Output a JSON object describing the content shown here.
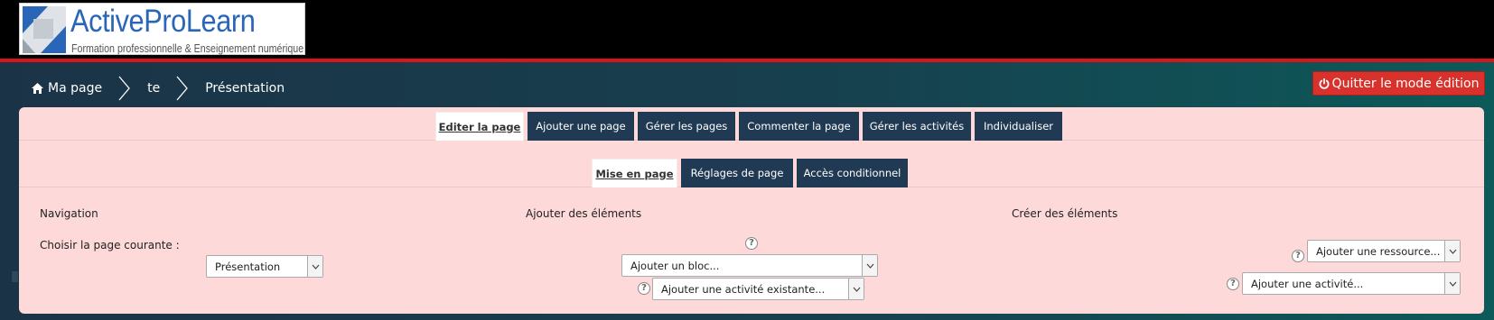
{
  "logo": {
    "title": "ActiveProLearn",
    "subtitle": "Formation professionnelle & Enseignement numérique",
    "colors": {
      "primary": "#2a66b8",
      "secondary": "#d0d4da"
    }
  },
  "breadcrumb": {
    "items": [
      {
        "label": "Ma page",
        "icon": "home-icon"
      },
      {
        "label": "te"
      },
      {
        "label": "Présentation"
      }
    ]
  },
  "quit_button": {
    "label": "Quitter le mode édition",
    "icon": "power-icon",
    "color": "#d9312b"
  },
  "tabs_primary": [
    {
      "label": "Editer la page",
      "active": true
    },
    {
      "label": "Ajouter une page",
      "active": false
    },
    {
      "label": "Gérer les pages",
      "active": false
    },
    {
      "label": "Commenter la page",
      "active": false
    },
    {
      "label": "Gérer les activités",
      "active": false
    },
    {
      "label": "Individualiser",
      "active": false
    }
  ],
  "tabs_secondary": [
    {
      "label": "Mise en page",
      "active": true
    },
    {
      "label": "Réglages de page",
      "active": false
    },
    {
      "label": "Accès conditionnel",
      "active": false
    }
  ],
  "sections": {
    "navigation": {
      "title": "Navigation",
      "current_page_label": "Choisir la page courante :",
      "current_page_value": "Présentation"
    },
    "add_elements": {
      "title": "Ajouter des éléments",
      "add_block_value": "Ajouter un bloc...",
      "add_existing_activity_value": "Ajouter une activité existante..."
    },
    "create_elements": {
      "title": "Créer des éléments",
      "add_resource_value": "Ajouter une ressource...",
      "add_activity_value": "Ajouter une activité..."
    }
  },
  "help_glyph": "?",
  "colors": {
    "panel": "#fdd9d9",
    "tab": "#1f3a52",
    "accent_red": "#d9141b"
  }
}
